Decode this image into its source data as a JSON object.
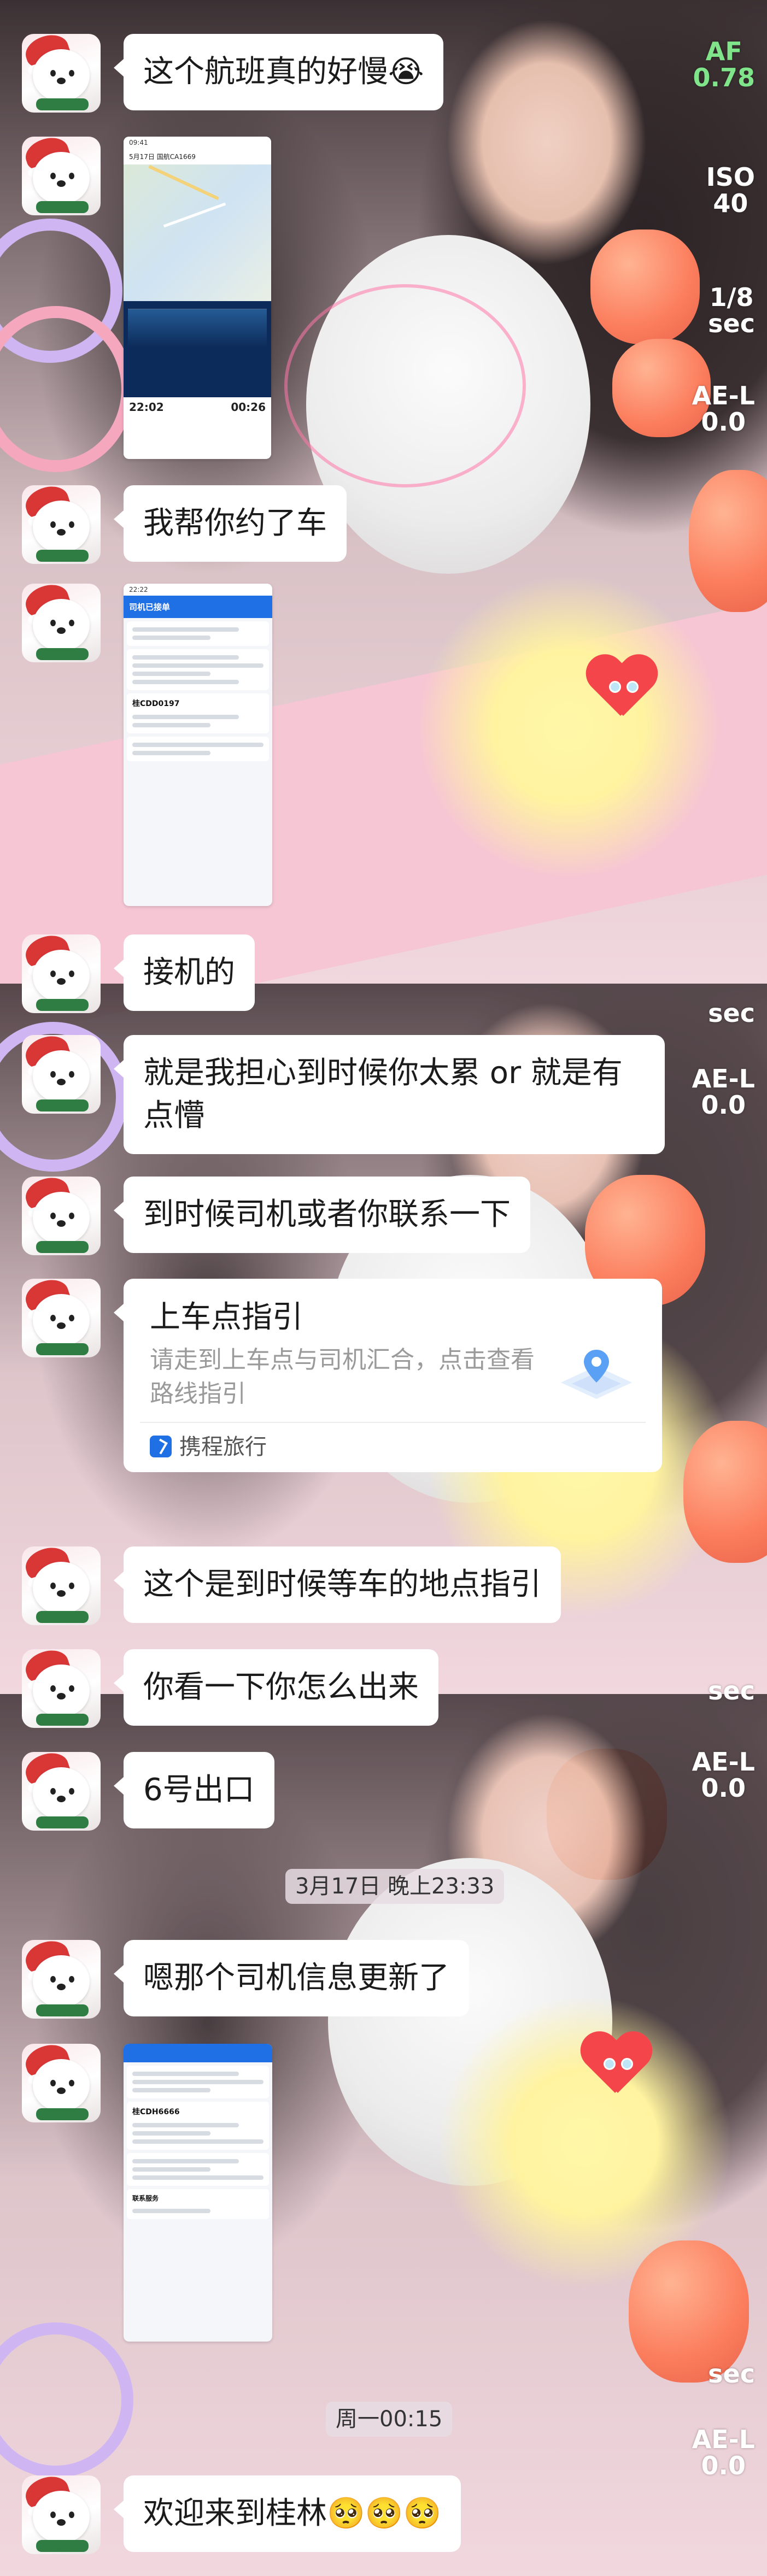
{
  "camera_hud": {
    "af_label": "AF",
    "af_value": "0.78",
    "iso_label": "ISO",
    "iso_value": "40",
    "shutter_label": "1/8",
    "shutter_unit": "sec",
    "ae_label": "AE-L",
    "ae_value": "0.0",
    "colors": {
      "af": "#7fe48a",
      "default": "#ffffff"
    }
  },
  "messages": [
    {
      "type": "text",
      "text": "这个航班真的好慢😭"
    },
    {
      "type": "image",
      "image_kind": "flight-tracker-screenshot",
      "content": {
        "status": "09:41",
        "top": "5月17日 国航CA1669",
        "dep_time": "22:02",
        "arr_time": "00:26"
      }
    },
    {
      "type": "text",
      "text": "我帮你约了车"
    },
    {
      "type": "image",
      "image_kind": "ride-order-screenshot",
      "content": {
        "status": "22:22",
        "header": "司机已接单",
        "plate": "桂CDD0197"
      }
    },
    {
      "type": "text",
      "text": "接机的"
    },
    {
      "type": "text",
      "text": "就是我担心到时候你太累 or 就是有点懵"
    },
    {
      "type": "text",
      "text": "到时候司机或者你联系一下"
    },
    {
      "type": "card",
      "title": "上车点指引",
      "desc": "请走到上车点与司机汇合，点击查看路线指引",
      "source": "携程旅行",
      "icon": "map-pin-icon"
    },
    {
      "type": "text",
      "text": "这个是到时候等车的地点指引"
    },
    {
      "type": "text",
      "text": "你看一下你怎么出来"
    },
    {
      "type": "text",
      "text": "6号出口"
    },
    {
      "type": "time",
      "text": "3月17日 晚上23:33"
    },
    {
      "type": "text",
      "text": "嗯那个司机信息更新了"
    },
    {
      "type": "image",
      "image_kind": "ride-driver-screenshot",
      "content": {
        "plate": "桂CDH6666",
        "section": "联系服务"
      }
    },
    {
      "type": "time",
      "text": "周一00:15"
    },
    {
      "type": "text",
      "text": "欢迎来到桂林🥺🥺🥺"
    }
  ]
}
